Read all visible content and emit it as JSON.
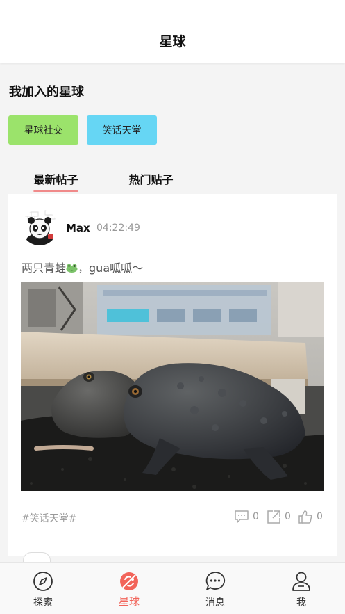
{
  "header": {
    "title": "星球"
  },
  "joined": {
    "title": "我加入的星球",
    "planets": [
      {
        "label": "星球社交",
        "color": "#9be36b"
      },
      {
        "label": "笑话天堂",
        "color": "#66d6f4"
      }
    ]
  },
  "feed_tabs": [
    {
      "label": "最新帖子",
      "active": true
    },
    {
      "label": "热门贴子",
      "active": false
    }
  ],
  "accent_color": "#f2645a",
  "post": {
    "author": "Max",
    "time": "04:22:49",
    "text_before": "两只青蛙",
    "emoji": "frog-emoji",
    "text_after": "，gua呱呱～",
    "tag": "#笑话天堂#",
    "comments": "0",
    "shares": "0",
    "likes": "0"
  },
  "bottom_nav": [
    {
      "label": "探索",
      "icon": "compass-icon",
      "active": false
    },
    {
      "label": "星球",
      "icon": "planet-icon",
      "active": true
    },
    {
      "label": "消息",
      "icon": "message-icon",
      "active": false
    },
    {
      "label": "我",
      "icon": "user-icon",
      "active": false
    }
  ]
}
